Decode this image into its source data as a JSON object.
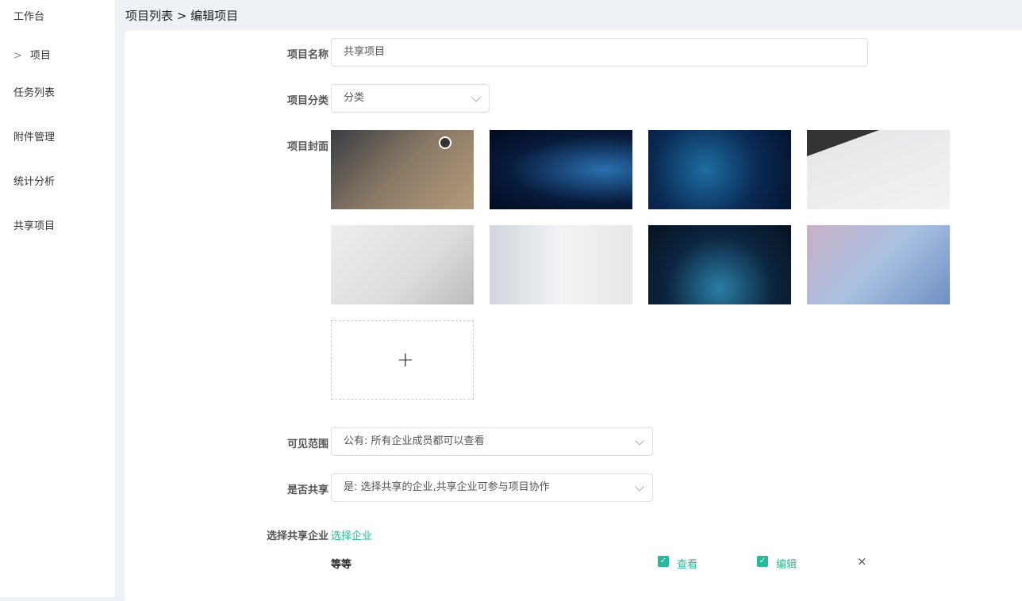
{
  "sidebar": {
    "items": [
      {
        "label": "工作台"
      },
      {
        "label": "项目"
      },
      {
        "label": "任务列表"
      },
      {
        "label": "附件管理"
      },
      {
        "label": "统计分析"
      },
      {
        "label": "共享项目"
      }
    ]
  },
  "breadcrumb": "项目列表 > 编辑项目",
  "form": {
    "name_label": "项目名称",
    "name_value": "共享项目",
    "category_label": "项目分类",
    "category_value": "分类",
    "cover_label": "项目封面",
    "visibility_label": "可见范围",
    "visibility_value": "公有: 所有企业成员都可以查看",
    "share_label": "是否共享",
    "share_value": "是: 选择共享的企业,共享企业可参与项目协作",
    "company_label": "选择共享企业",
    "company_link": "选择企业",
    "company_row": {
      "name": "等等",
      "view": "查看",
      "edit": "编辑",
      "remove": "×"
    }
  },
  "colors": {
    "accent": "#26b99a"
  }
}
